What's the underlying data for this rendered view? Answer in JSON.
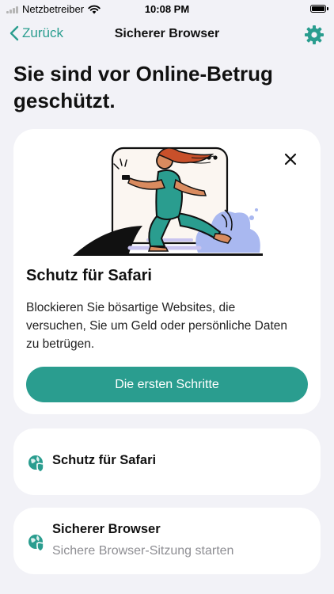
{
  "status_bar": {
    "carrier": "Netzbetreiber",
    "time": "10:08 PM"
  },
  "nav": {
    "back_label": "Zurück",
    "title": "Sicherer Browser",
    "settings_icon": "gear-icon"
  },
  "page": {
    "title": "Sie sind vor Online-Betrug geschützt."
  },
  "promo_card": {
    "title": "Schutz für Safari",
    "description": "Blockieren Sie bösartige Websites, die versuchen, Sie um Geld oder persönliche Daten zu betrügen.",
    "cta_label": "Die ersten Schritte",
    "close_icon": "close-icon"
  },
  "list": [
    {
      "title": "Schutz für Safari",
      "subtitle": "",
      "icon": "globe-shield-icon"
    },
    {
      "title": "Sicherer Browser",
      "subtitle": "Sichere Browser-Sitzung starten",
      "icon": "globe-shield-icon"
    }
  ],
  "colors": {
    "accent": "#2a9d8f",
    "background": "#f2f2f7",
    "card": "#ffffff",
    "secondary_text": "#8e8e93"
  }
}
